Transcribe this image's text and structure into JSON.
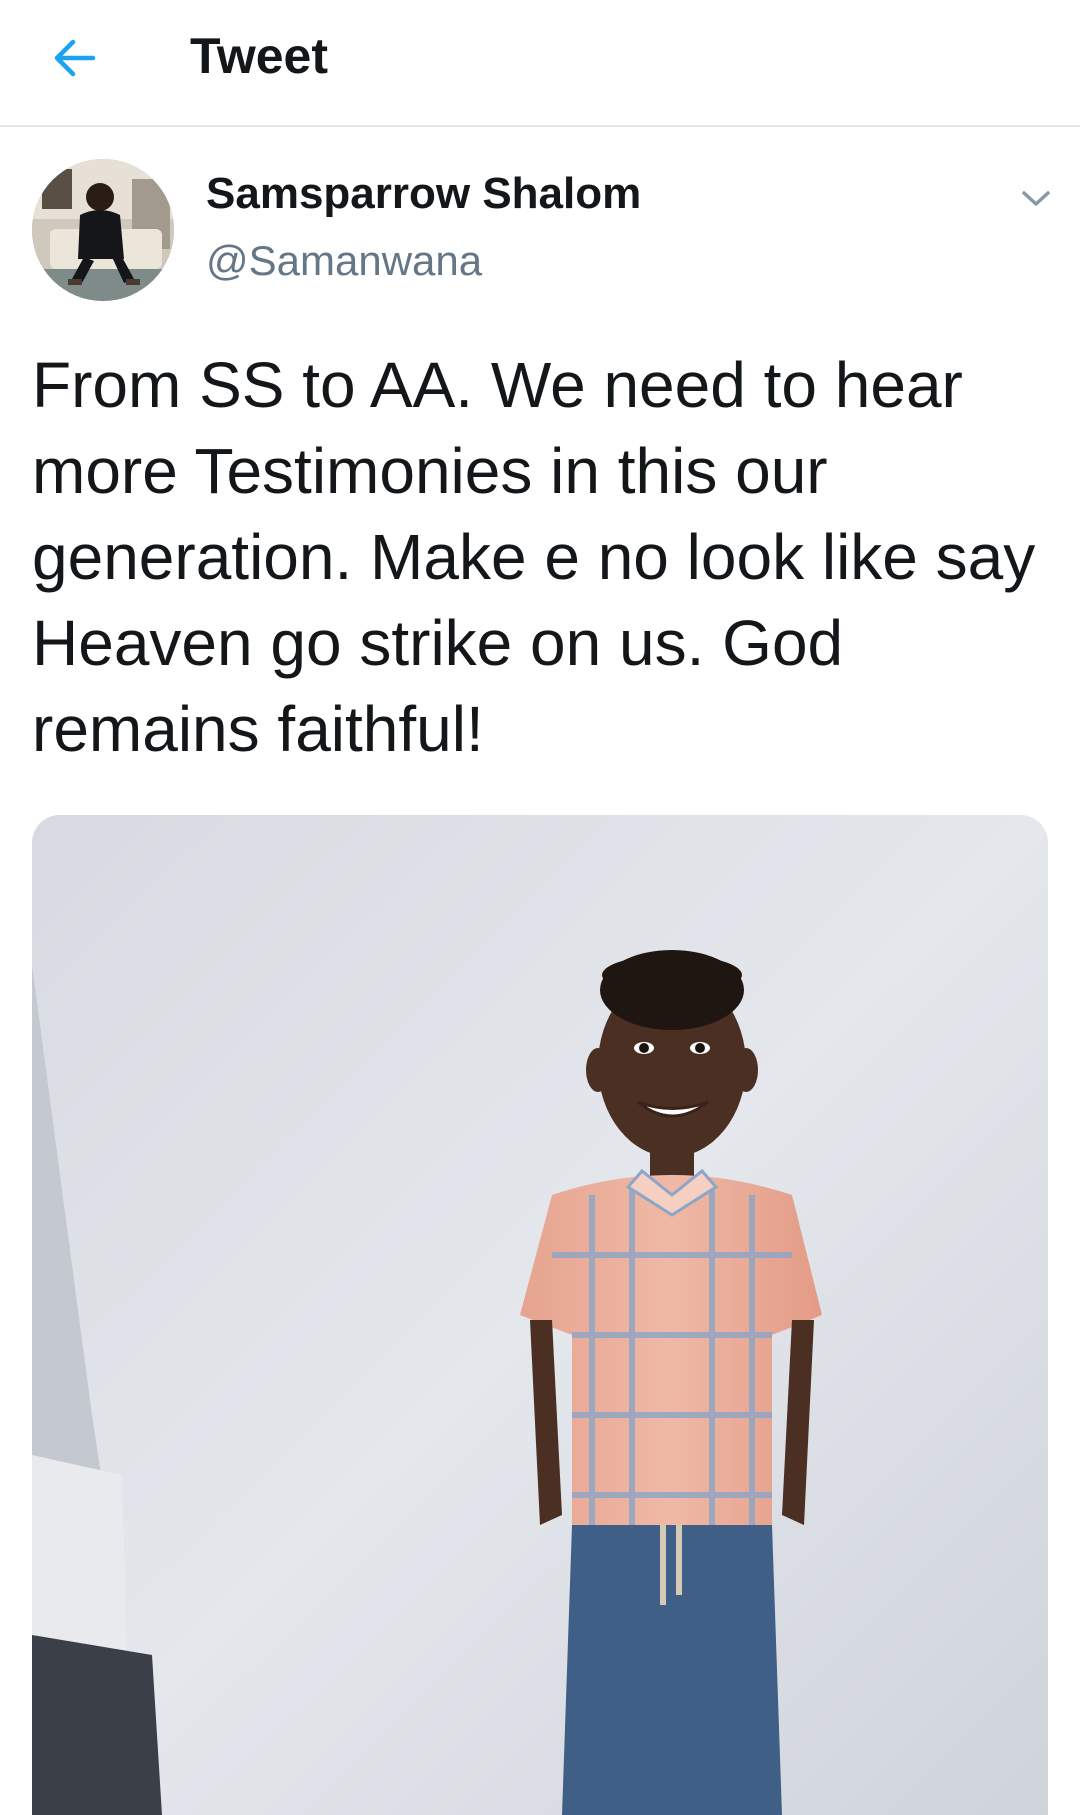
{
  "header": {
    "title": "Tweet",
    "back_icon": "arrow-left-icon",
    "accent_color": "#1da1f2"
  },
  "tweet": {
    "author_name": "Samsparrow Shalom",
    "author_handle": "@Samanwana",
    "text": "From SS to AA. We need to hear more Testimonies in this our generation. Make e no look like say Heaven go strike on us. God remains faithful!",
    "menu_icon": "chevron-down-icon",
    "media_description_icon": "photo"
  },
  "colors": {
    "text_primary": "#14171a",
    "text_secondary": "#657786",
    "divider": "#e1e8ed"
  }
}
